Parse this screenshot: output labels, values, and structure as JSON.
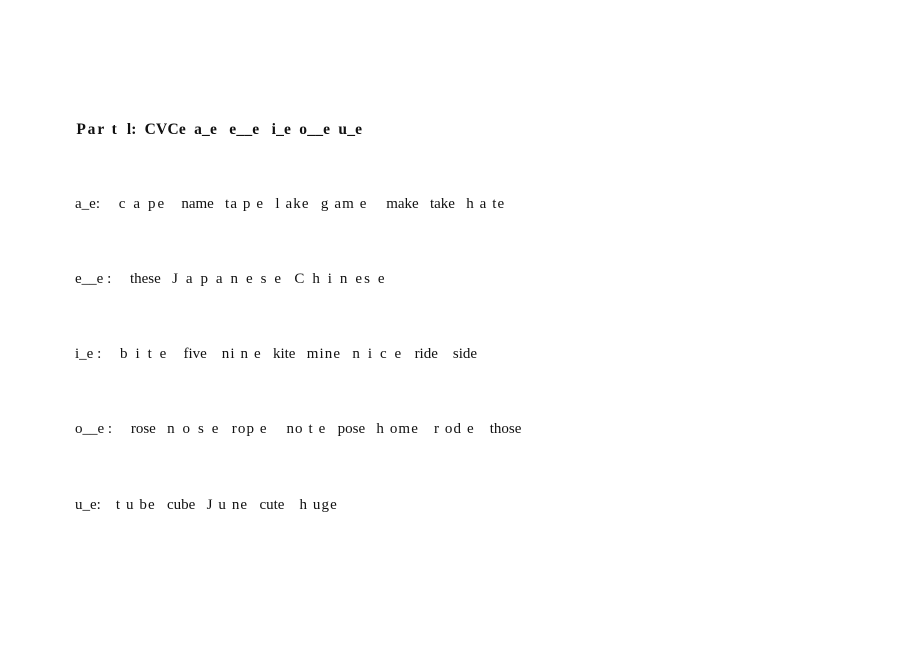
{
  "document": {
    "page_background": "#ffffff",
    "text_color": "#101010",
    "title": {
      "full_text": "Par t  l:  CVCe  a_e   e__e   i_e  o__e  u_e",
      "segments": [
        "Par t",
        "l:",
        "CVCe",
        "a_e",
        "e__e",
        "i_e",
        "o__e",
        "u_e"
      ],
      "bold": true
    },
    "rows": [
      {
        "label": "a_e:",
        "words": [
          "c a pe",
          "name",
          "ta p e",
          "l ake",
          "g am e",
          "make",
          "take",
          "h a te"
        ],
        "clean_words": [
          "cape",
          "name",
          "tape",
          "lake",
          "game",
          "make",
          "take",
          "hate"
        ]
      },
      {
        "label": "e__e :",
        "words": [
          "these",
          "J a p a n e s e",
          "C h i n es e"
        ],
        "clean_words": [
          "these",
          "Japanese",
          "Chinese"
        ]
      },
      {
        "label": "i_e :",
        "words": [
          "b i t e",
          "five",
          "ni n e",
          "kite",
          "mine",
          "n i c e",
          "ride",
          "side"
        ],
        "clean_words": [
          "bite",
          "five",
          "nine",
          "kite",
          "mine",
          "nice",
          "ride",
          "side"
        ]
      },
      {
        "label": "o__e :",
        "words": [
          "rose",
          "n o s e",
          "rop e",
          "no t e",
          "pose",
          "h ome",
          "r od e",
          "those"
        ],
        "clean_words": [
          "rose",
          "nose",
          "rope",
          "note",
          "pose",
          "home",
          "rode",
          "those"
        ]
      },
      {
        "label": "u_e:",
        "words": [
          "t u be",
          "cube",
          "J u ne",
          "cute",
          "h uge"
        ],
        "clean_words": [
          "tube",
          "cube",
          "June",
          "cute",
          "huge"
        ]
      }
    ]
  }
}
